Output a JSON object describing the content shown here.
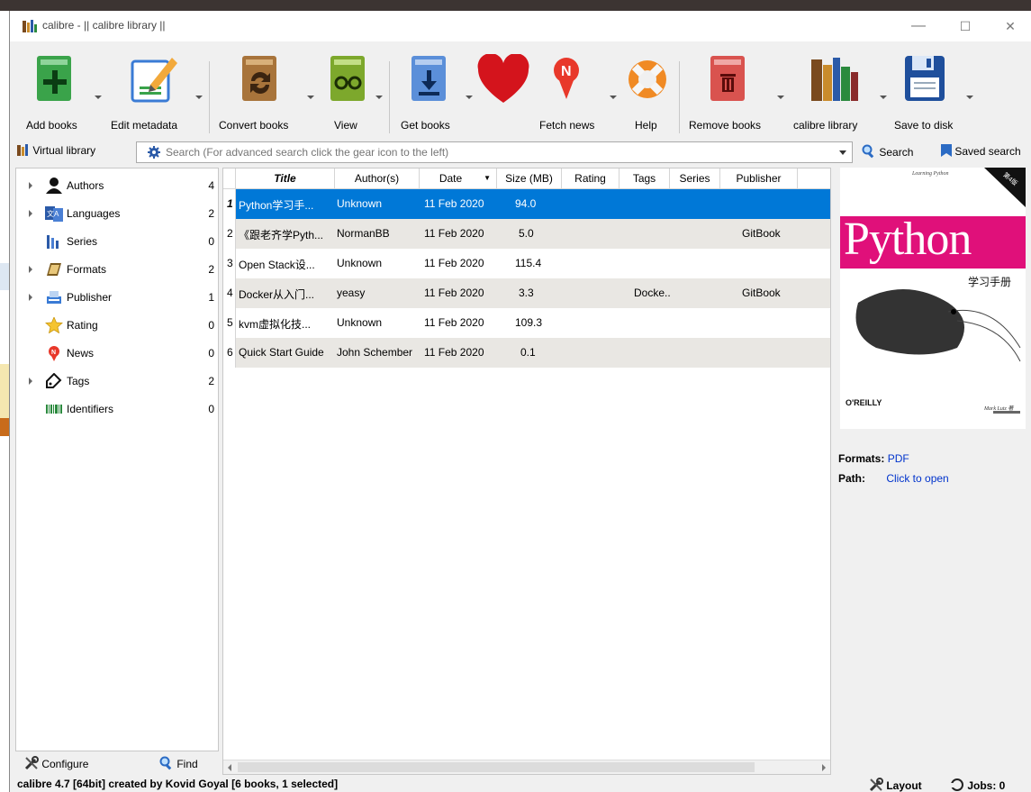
{
  "window": {
    "title": "calibre - || calibre library ||",
    "minimize": "—",
    "maximize": "☐",
    "close": "✕"
  },
  "toolbar": {
    "add_books": "Add books",
    "edit_metadata": "Edit metadata",
    "convert_books": "Convert books",
    "view": "View",
    "get_books": "Get books",
    "fetch_news": "Fetch news",
    "help": "Help",
    "remove_books": "Remove books",
    "calibre_library": "calibre library",
    "save_to_disk": "Save to disk"
  },
  "searchbar": {
    "virtual_library": "Virtual library",
    "placeholder": "Search (For advanced search click the gear icon to the left)",
    "search_label": "Search",
    "saved_search_label": "Saved search"
  },
  "tag_browser": {
    "items": [
      {
        "name": "Authors",
        "count": "4",
        "expandable": true
      },
      {
        "name": "Languages",
        "count": "2",
        "expandable": true
      },
      {
        "name": "Series",
        "count": "0",
        "expandable": false
      },
      {
        "name": "Formats",
        "count": "2",
        "expandable": true
      },
      {
        "name": "Publisher",
        "count": "1",
        "expandable": true
      },
      {
        "name": "Rating",
        "count": "0",
        "expandable": false
      },
      {
        "name": "News",
        "count": "0",
        "expandable": false
      },
      {
        "name": "Tags",
        "count": "2",
        "expandable": true
      },
      {
        "name": "Identifiers",
        "count": "0",
        "expandable": false
      }
    ],
    "configure": "Configure",
    "find": "Find"
  },
  "book_table": {
    "columns": [
      "Title",
      "Author(s)",
      "Date",
      "Size (MB)",
      "Rating",
      "Tags",
      "Series",
      "Publisher"
    ],
    "sort_indicator": "▼",
    "rows": [
      {
        "num": "1",
        "title": "Python学习手...",
        "author": "Unknown",
        "date": "11 Feb 2020",
        "size": "94.0",
        "rating": "",
        "tags": "",
        "series": "",
        "publisher": ""
      },
      {
        "num": "2",
        "title": "《跟老齐学Pyth...",
        "author": "NormanBB",
        "date": "11 Feb 2020",
        "size": "5.0",
        "rating": "",
        "tags": "",
        "series": "",
        "publisher": "GitBook"
      },
      {
        "num": "3",
        "title": "Open Stack设...",
        "author": "Unknown",
        "date": "11 Feb 2020",
        "size": "115.4",
        "rating": "",
        "tags": "",
        "series": "",
        "publisher": ""
      },
      {
        "num": "4",
        "title": "Docker从入门...",
        "author": "yeasy",
        "date": "11 Feb 2020",
        "size": "3.3",
        "rating": "",
        "tags": "Docke...",
        "series": "",
        "publisher": "GitBook"
      },
      {
        "num": "5",
        "title": "kvm虚拟化技...",
        "author": "Unknown",
        "date": "11 Feb 2020",
        "size": "109.3",
        "rating": "",
        "tags": "",
        "series": "",
        "publisher": ""
      },
      {
        "num": "6",
        "title": "Quick Start Guide",
        "author": "John Schember",
        "date": "11 Feb 2020",
        "size": "0.1",
        "rating": "",
        "tags": "",
        "series": "",
        "publisher": ""
      }
    ],
    "selected_row": 0
  },
  "details": {
    "cover": {
      "small_title": "Learning Python",
      "banner": "第4版",
      "big_title": "Python",
      "subtitle": "学习手册",
      "publisher": "O'REILLY",
      "author": "Mark Lutz 著"
    },
    "formats_label": "Formats:",
    "formats_value": "PDF",
    "path_label": "Path:",
    "path_value": "Click to open"
  },
  "status": {
    "message": "calibre 4.7 [64bit] created by Kovid Goyal    [6 books, 1 selected]",
    "layout": "Layout",
    "jobs": "Jobs: 0"
  },
  "colors": {
    "selection": "#0078d7",
    "alt_row": "#e9e7e3",
    "cover_magenta": "#e0107a"
  }
}
